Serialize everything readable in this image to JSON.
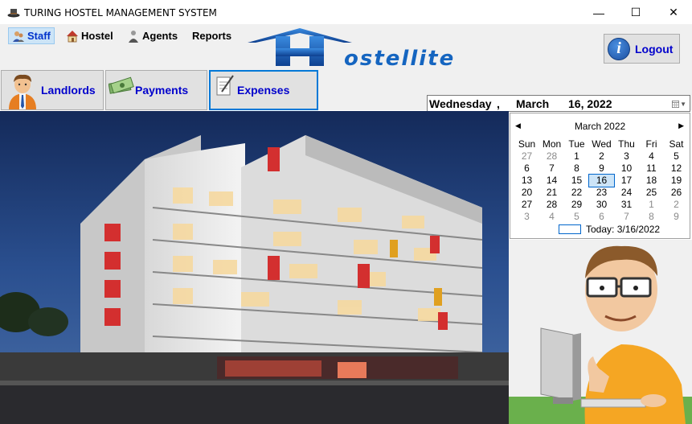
{
  "window": {
    "title": "TURING HOSTEL MANAGEMENT SYSTEM",
    "minimize_glyph": "—",
    "maximize_glyph": "☐",
    "close_glyph": "✕"
  },
  "menu": {
    "items": [
      {
        "label": "Staff",
        "icon": "staff-icon"
      },
      {
        "label": "Hostel",
        "icon": "house-icon"
      },
      {
        "label": "Agents",
        "icon": "agents-icon"
      },
      {
        "label": "Reports",
        "icon": ""
      }
    ]
  },
  "logo": {
    "text_rest": "ostellite",
    "letter": "H"
  },
  "logout": {
    "label": "Logout",
    "icon": "info-icon",
    "icon_glyph": "i"
  },
  "tabs": [
    {
      "label": "Landlords",
      "icon": "landlord-icon"
    },
    {
      "label": "Payments",
      "icon": "money-icon"
    },
    {
      "label": "Expenses",
      "icon": "notepad-icon"
    }
  ],
  "datepicker": {
    "day": "Wednesday",
    "month": "March",
    "date": "16, 2022",
    "dropdown_icon": "calendar-dropdown-icon"
  },
  "calendar": {
    "title": "March 2022",
    "prev_glyph": "◀",
    "next_glyph": "▶",
    "weekdays": [
      "Sun",
      "Mon",
      "Tue",
      "Wed",
      "Thu",
      "Fri",
      "Sat"
    ],
    "weeks": [
      [
        "27",
        "28",
        "1",
        "2",
        "3",
        "4",
        "5"
      ],
      [
        "6",
        "7",
        "8",
        "9",
        "10",
        "11",
        "12"
      ],
      [
        "13",
        "14",
        "15",
        "16",
        "17",
        "18",
        "19"
      ],
      [
        "20",
        "21",
        "22",
        "23",
        "24",
        "25",
        "26"
      ],
      [
        "27",
        "28",
        "29",
        "30",
        "31",
        "1",
        "2"
      ],
      [
        "3",
        "4",
        "5",
        "6",
        "7",
        "8",
        "9"
      ]
    ],
    "selected": "16",
    "today_label": "Today: 3/16/2022"
  },
  "colors": {
    "accent": "#0000cc",
    "selection": "#cce4f7",
    "logo_blue": "#1565c0"
  }
}
